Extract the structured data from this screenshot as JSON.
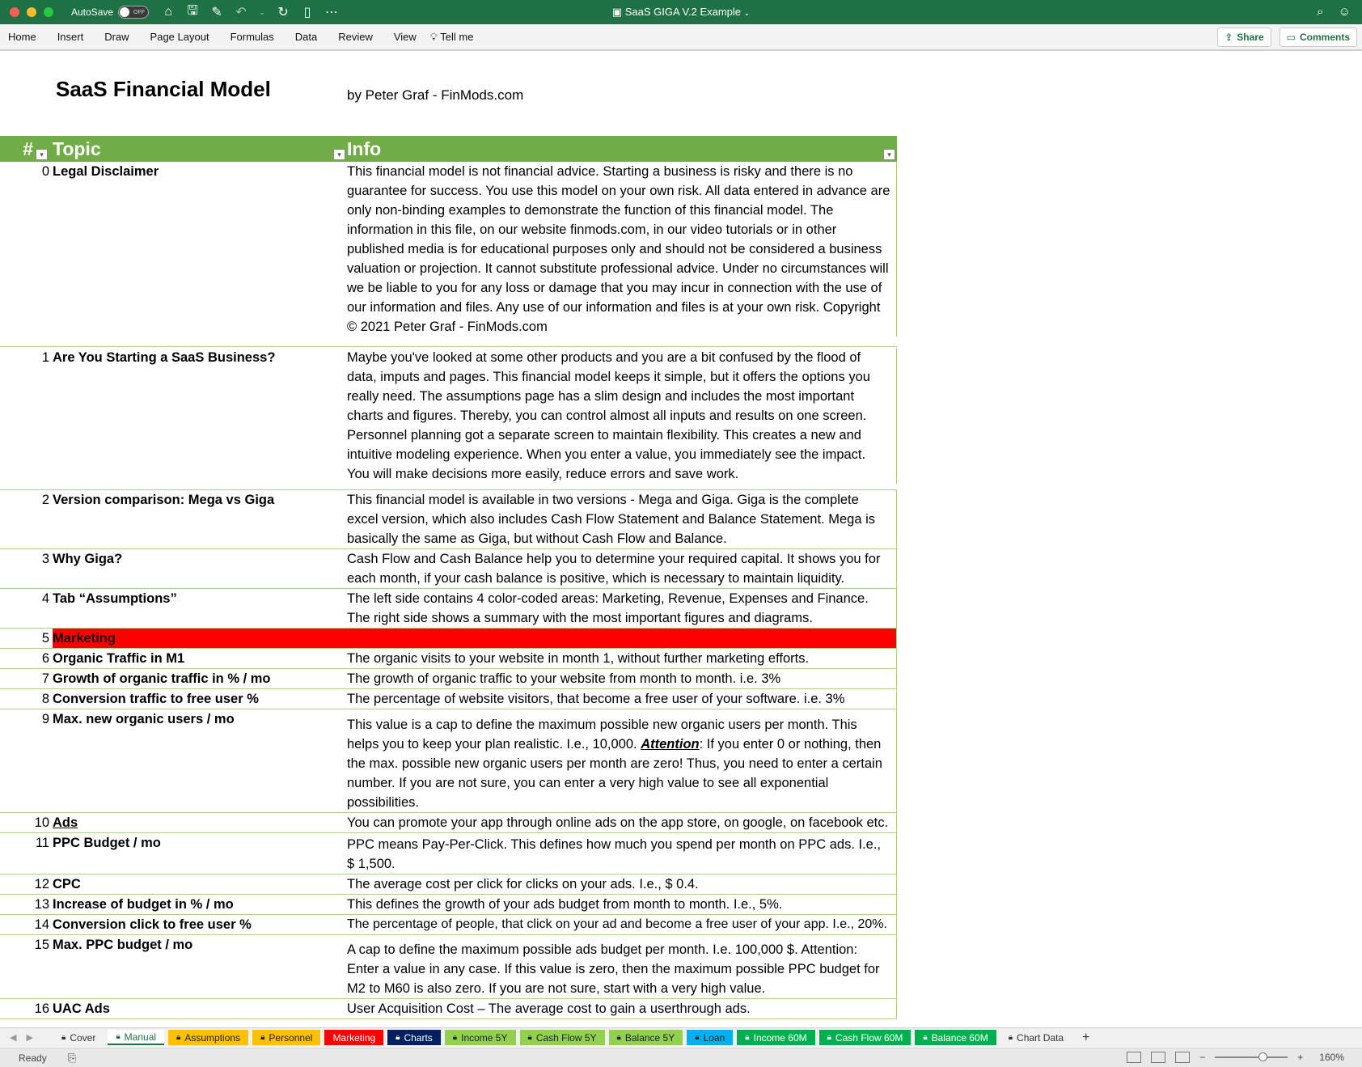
{
  "window": {
    "title": "SaaS GIGA V.2 Example",
    "autosave_label": "AutoSave",
    "autosave_state": "OFF"
  },
  "ribbon": {
    "tabs": [
      "Home",
      "Insert",
      "Draw",
      "Page Layout",
      "Formulas",
      "Data",
      "Review",
      "View",
      "Tell me"
    ],
    "share_label": "Share",
    "comments_label": "Comments"
  },
  "sheet": {
    "title": "SaaS Financial Model",
    "byline": "by Peter Graf - FinMods.com",
    "headers": {
      "num": "#",
      "topic": "Topic",
      "info": "Info"
    },
    "rows": [
      {
        "num": "0",
        "topic": "Legal Disclaimer",
        "info": "This financial model is not financial advice. Starting a business is risky and there is no guarantee for success. You use this model on your own risk. All data entered in advance are only non-binding examples to demonstrate the function of this financial model. The information in this file, on our website finmods.com, in our video tutorials or in other published media is for educational purposes only and should not be considered a business valuation or projection. It cannot substitute professional advice. Under no circumstances will we be liable to you for any loss or damage that you may incur in connection with the use of our information and files. Any use of our information and files is at your own risk. Copyright © 2021 Peter Graf - FinMods.com"
      },
      {
        "num": "1",
        "topic": "Are You Starting a SaaS Business?",
        "info": "Maybe you've looked at some other products and you are a bit confused by the flood of data, imputs and pages. This financial model keeps it simple, but it offers the options you really need. The assumptions page has a slim design and includes the most important charts and figures.   Thereby, you can control almost all inputs and results on one screen. Personnel planning got a separate screen to maintain flexibility. This creates a new and intuitive modeling experience. When you enter a value, you immediately see the impact. You will make decisions more easily, reduce errors and save work."
      },
      {
        "num": "2",
        "topic": "Version comparison: Mega vs Giga",
        "info": "This financial model is available in two versions - Mega and Giga. Giga is the complete excel version, which also includes Cash Flow Statement and Balance Statement. Mega is basically the same as Giga, but without Cash Flow and Balance."
      },
      {
        "num": "3",
        "topic": "Why Giga?",
        "info": "Cash Flow and Cash Balance help you to determine your required capital. It shows you for each month, if your cash balance is positive, which is necessary to maintain liquidity."
      },
      {
        "num": "4",
        "topic": "Tab “Assumptions”",
        "info": "The left side contains 4 color-coded areas: Marketing, Revenue, Expenses and Finance. The right side shows a summary with the most important figures and diagrams."
      },
      {
        "num": "5",
        "topic": "Marketing",
        "info": ""
      },
      {
        "num": "6",
        "topic": "Organic Traffic in M1",
        "info": "The organic visits to your website in month 1, without further marketing efforts."
      },
      {
        "num": "7",
        "topic": "Growth of organic traffic in % / mo",
        "info": "The growth of organic traffic to your website from month to month. i.e. 3%"
      },
      {
        "num": "8",
        "topic": "Conversion traffic to free user %",
        "info": "The percentage of website visitors, that become a free user of your software. i.e. 3%"
      },
      {
        "num": "9",
        "topic": "Max. new organic users / mo",
        "info_a": "This value is a cap to define the maximum possible new organic users per month. This helps you to keep your plan realistic. I.e., 10,000. ",
        "info_attention": "Attention",
        "info_b": ": If you enter 0 or nothing, then the max. possible new organic users per month are zero! Thus, you need to enter a certain number. If you are not sure, you can enter a very high value to see all exponential possibilities."
      },
      {
        "num": "10",
        "topic": "Ads",
        "info": "You can promote your app through online ads on the app store, on google, on facebook etc."
      },
      {
        "num": "11",
        "topic": "PPC Budget / mo",
        "info": "PPC means Pay-Per-Click. This defines how much you spend per month on PPC ads. I.e., $ 1,500."
      },
      {
        "num": "12",
        "topic": "CPC",
        "info": "The average cost per click for clicks on your ads. I.e., $ 0.4."
      },
      {
        "num": "13",
        "topic": "Increase of budget in % / mo",
        "info": "This defines the growth of your ads budget from month to month. I.e., 5%."
      },
      {
        "num": "14",
        "topic": "Conversion click to free user %",
        "info": "The percentage of people, that click on your ad and become a free user of your app. I.e., 20%."
      },
      {
        "num": "15",
        "topic": "Max. PPC budget / mo",
        "info": "A cap to define the maximum possible ads budget per month. I.e. 100,000 $. Attention: Enter a value in any case. If this value is zero, then the maximum possible PPC budget for M2 to M60 is also zero. If you are not sure, start with a very high value."
      },
      {
        "num": "16",
        "topic": "UAC Ads",
        "info": "User Acquisition Cost – The average cost to gain a userthrough ads."
      }
    ]
  },
  "sheet_tabs": [
    {
      "label": "Cover",
      "color": "#f0f0f0",
      "text": "#333333",
      "locked": true
    },
    {
      "label": "Manual",
      "color": "#ffffff",
      "text": "#1e7145",
      "locked": true
    },
    {
      "label": "Assumptions",
      "color": "#ffc000",
      "text": "#222222",
      "locked": true
    },
    {
      "label": "Personnel",
      "color": "#ffc000",
      "text": "#222222",
      "locked": true
    },
    {
      "label": "Marketing",
      "color": "#ff0000",
      "text": "#ffffff",
      "locked": false
    },
    {
      "label": "Charts",
      "color": "#002060",
      "text": "#ffffff",
      "locked": true
    },
    {
      "label": "Income 5Y",
      "color": "#92d050",
      "text": "#222222",
      "locked": true
    },
    {
      "label": "Cash Flow 5Y",
      "color": "#92d050",
      "text": "#222222",
      "locked": true
    },
    {
      "label": "Balance 5Y",
      "color": "#92d050",
      "text": "#222222",
      "locked": true
    },
    {
      "label": "Loan",
      "color": "#00b0f0",
      "text": "#222222",
      "locked": true
    },
    {
      "label": "Income 60M",
      "color": "#00b050",
      "text": "#ffffff",
      "locked": true
    },
    {
      "label": "Cash Flow 60M",
      "color": "#00b050",
      "text": "#ffffff",
      "locked": true
    },
    {
      "label": "Balance 60M",
      "color": "#00b050",
      "text": "#ffffff",
      "locked": true
    },
    {
      "label": "Chart Data",
      "color": "#f0f0f0",
      "text": "#333333",
      "locked": true
    }
  ],
  "status": {
    "ready": "Ready",
    "zoom": "160%"
  },
  "colors": {
    "titlebar": "#1e7145",
    "header_green": "#70ad47",
    "row_border": "#a9d08e",
    "section_red": "#ff0000"
  }
}
